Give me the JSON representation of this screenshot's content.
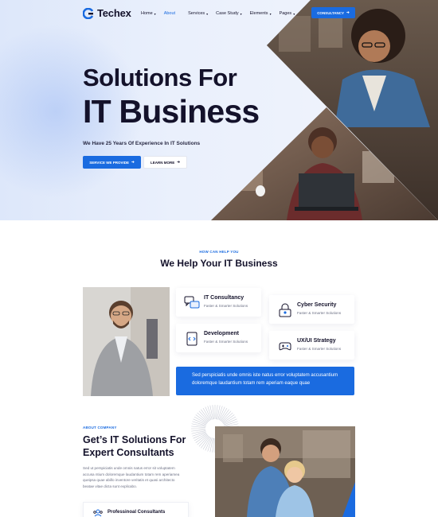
{
  "header": {
    "logo_text": "Techex",
    "nav": [
      {
        "label": "Home",
        "has_caret": true,
        "active": false
      },
      {
        "label": "About",
        "has_caret": false,
        "active": true
      },
      {
        "label": "Services",
        "has_caret": true,
        "active": false
      },
      {
        "label": "Case Study",
        "has_caret": true,
        "active": false
      },
      {
        "label": "Elements",
        "has_caret": true,
        "active": false
      },
      {
        "label": "Pages",
        "has_caret": true,
        "active": false
      }
    ],
    "cta_label": "CONSULTANCY",
    "accent_color": "#1a6be0"
  },
  "hero": {
    "title_line1": "Solutions For",
    "title_line2": "IT Business",
    "subtitle": "We Have 25 Years Of Experience In IT Solutions",
    "primary_button": "SERVICE WE PROVIDE",
    "secondary_button": "LEARN MORE"
  },
  "services": {
    "eyebrow": "HOW CAN HELP YOU",
    "title": "We Help Your IT Business",
    "items": [
      {
        "title": "IT Consultancy",
        "subtitle": "Faster & Smarter Solutions",
        "icon": "chat-icon"
      },
      {
        "title": "Cyber Security",
        "subtitle": "Faster & Smarter Solutions",
        "icon": "lock-icon"
      },
      {
        "title": "Development",
        "subtitle": "Faster & Smarter Solutions",
        "icon": "code-icon"
      },
      {
        "title": "UX/UI Strategy",
        "subtitle": "Faster & Smarter Solutions",
        "icon": "gamepad-icon"
      }
    ],
    "banner_line1": "Sed perspiciatis unde omnis iste natus error voluptatem accusantium",
    "banner_line2": "doloremque laudantium totam rem aperiam eaque quae"
  },
  "about": {
    "eyebrow": "ABOUT COMPANY",
    "title_line1": "Get’s IT Solutions For",
    "title_line2": "Expert Consultants",
    "text_lines": [
      "Sed ut perspiciatis unde omnis natus error sit voluptatem",
      "accusa ntium doloremque laudantium totam rem aperiamea",
      "queipsa quae abillo inventore veritatis et quasi architecto",
      "beatae vitae dicta sunt explicabo."
    ],
    "feature_label": "Professinoal Consultants"
  }
}
